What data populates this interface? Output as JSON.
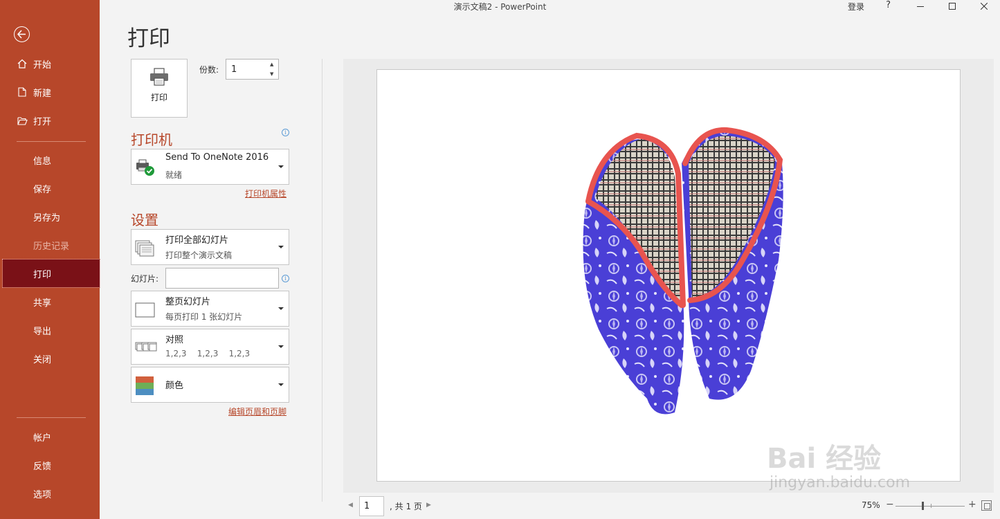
{
  "window": {
    "title": "演示文稿2  -  PowerPoint",
    "login": "登录",
    "help": "?"
  },
  "sidebar": {
    "back_icon": "back-arrow-icon",
    "items": [
      {
        "label": "开始",
        "icon": "home-icon"
      },
      {
        "label": "新建",
        "icon": "new-doc-icon"
      },
      {
        "label": "打开",
        "icon": "open-folder-icon"
      },
      {
        "label": "信息"
      },
      {
        "label": "保存"
      },
      {
        "label": "另存为"
      },
      {
        "label": "历史记录"
      },
      {
        "label": "打印"
      },
      {
        "label": "共享"
      },
      {
        "label": "导出"
      },
      {
        "label": "关闭"
      },
      {
        "label": "帐户"
      },
      {
        "label": "反馈"
      },
      {
        "label": "选项"
      }
    ],
    "active_item": "打印",
    "disabled_item": "历史记录"
  },
  "print": {
    "page_title": "打印",
    "button_label": "打印",
    "copies_label": "份数:",
    "copies_value": "1",
    "printer_section": "打印机",
    "printer": {
      "name": "Send To OneNote 2016",
      "status": "就绪"
    },
    "printer_props_link": "打印机属性",
    "settings_section": "设置",
    "settings": [
      {
        "main": "打印全部幻灯片",
        "sub": "打印整个演示文稿"
      },
      {
        "main": "整页幻灯片",
        "sub": "每页打印 1 张幻灯片"
      },
      {
        "main": "对照",
        "sub": "1,2,3    1,2,3    1,2,3"
      },
      {
        "main": "颜色",
        "sub": ""
      }
    ],
    "slides_label": "幻灯片:",
    "slides_value": "",
    "header_footer_link": "编辑页眉和页脚"
  },
  "preview": {
    "current_page": "1",
    "total_pages_text": ", 共 1 页",
    "zoom": "75%",
    "zoom_fraction": 0.4
  },
  "watermark": {
    "logo_text": "Bai 经验",
    "url": "jingyan.baidu.com"
  },
  "colors": {
    "accent": "#b7472a",
    "active": "#7a1117"
  }
}
